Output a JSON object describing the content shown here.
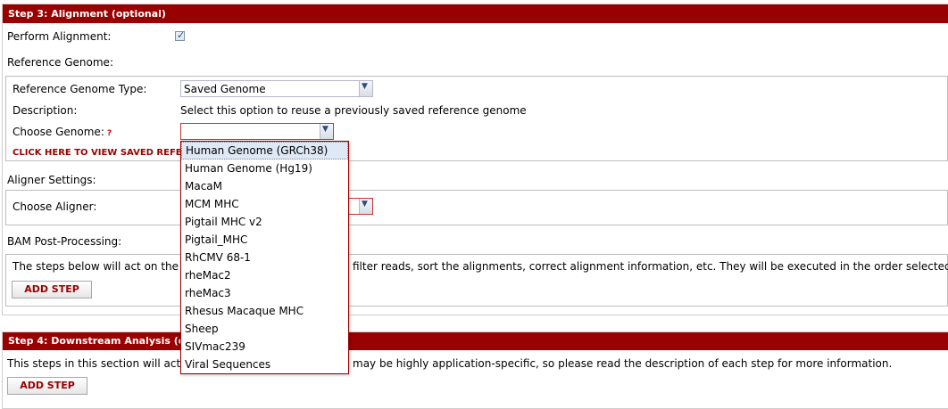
{
  "step3": {
    "header": "Step 3: Alignment (optional)",
    "perform_alignment_label": "Perform Alignment:",
    "perform_alignment_checked": true,
    "reference_genome_label": "Reference Genome:",
    "ref_type_label": "Reference Genome Type:",
    "ref_type_value": "Saved Genome",
    "description_label": "Description:",
    "description_value": "Select this option to reuse a previously saved reference genome",
    "choose_genome_label": "Choose Genome:",
    "choose_genome_help": "?",
    "choose_genome_value": "",
    "view_saved_link": "CLICK HERE TO VIEW SAVED REFERE",
    "aligner_settings_label": "Aligner Settings:",
    "choose_aligner_label": "Choose Aligner:",
    "bam_post_label": "BAM Post-Processing:",
    "bam_text_left": "The steps below will act on the B",
    "bam_text_right": "filter reads, sort the alignments, correct alignment information, etc. They will be executed in the order selected.",
    "add_step_label": "ADD STEP"
  },
  "step4": {
    "header": "Step 4: Downstream Analysis (opti",
    "text_left": "This steps in this section will act o",
    "text_right": "may be highly application-specific, so please read the description of each step for more information.",
    "add_step_label": "ADD STEP"
  },
  "genome_dropdown": {
    "selected": "Human Genome (GRCh38)",
    "options": [
      "Human Genome (GRCh38)",
      "Human Genome (Hg19)",
      "MacaM",
      "MCM MHC",
      "Pigtail MHC v2",
      "Pigtail_MHC",
      "RhCMV 68-1",
      "rheMac2",
      "rheMac3",
      "Rhesus Macaque MHC",
      "Sheep",
      "SIVmac239",
      "Viral Sequences"
    ]
  },
  "colors": {
    "header_bg": "#990000",
    "accent": "#990000",
    "selected_bg": "#dfe8f6"
  }
}
